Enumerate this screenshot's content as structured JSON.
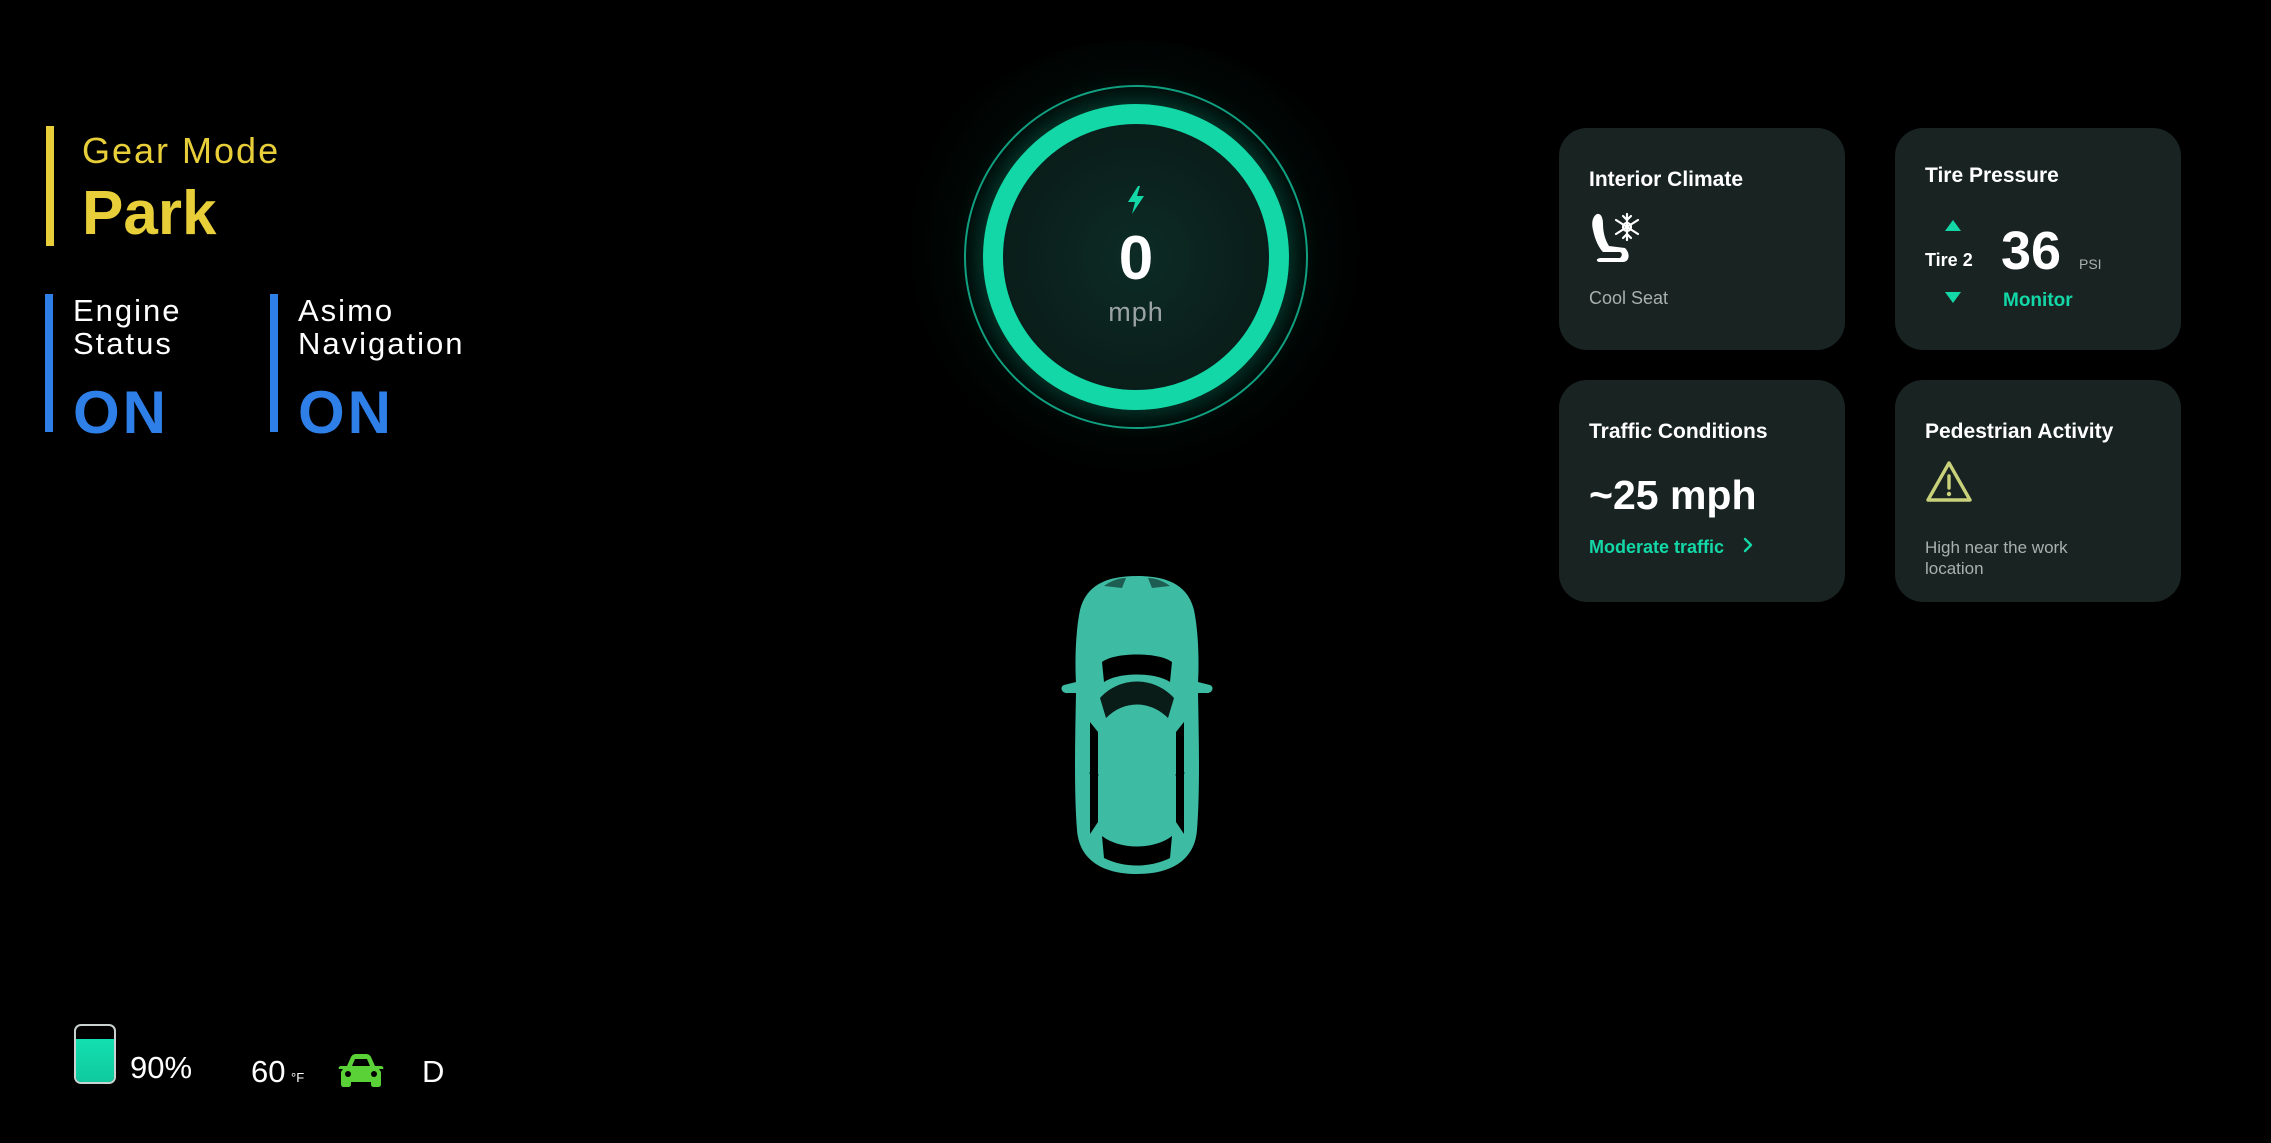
{
  "gear": {
    "label": "Gear Mode",
    "value": "Park"
  },
  "engine": {
    "label": "Engine Status",
    "value": "ON"
  },
  "navigation": {
    "label": "Asimo Navigation",
    "value": "ON"
  },
  "speedometer": {
    "value": "0",
    "unit": "mph",
    "icon": "lightning-bolt-icon"
  },
  "cards": {
    "climate": {
      "title": "Interior Climate",
      "label": "Cool Seat",
      "icon": "cool-seat-icon"
    },
    "tire": {
      "title": "Tire Pressure",
      "tire_label": "Tire 2",
      "value": "36",
      "unit": "PSI",
      "status": "Monitor"
    },
    "traffic": {
      "title": "Traffic Conditions",
      "value": "~25 mph",
      "link": "Moderate traffic"
    },
    "pedestrian": {
      "title": "Pedestrian Activity",
      "description": "High near the work location",
      "icon": "warning-icon"
    }
  },
  "bottom_bar": {
    "battery_percent": "90%",
    "battery_level": 0.9,
    "temperature": "60",
    "temperature_unit": "°F",
    "car_icon": "car-icon",
    "drive_mode": "D"
  },
  "colors": {
    "gear_accent": "#E8CF3A",
    "system_accent": "#2E7FE8",
    "teal_accent": "#13D7A6",
    "card_bg": "#192322",
    "warning": "#C9D27A",
    "car_mini": "#5BD138"
  }
}
